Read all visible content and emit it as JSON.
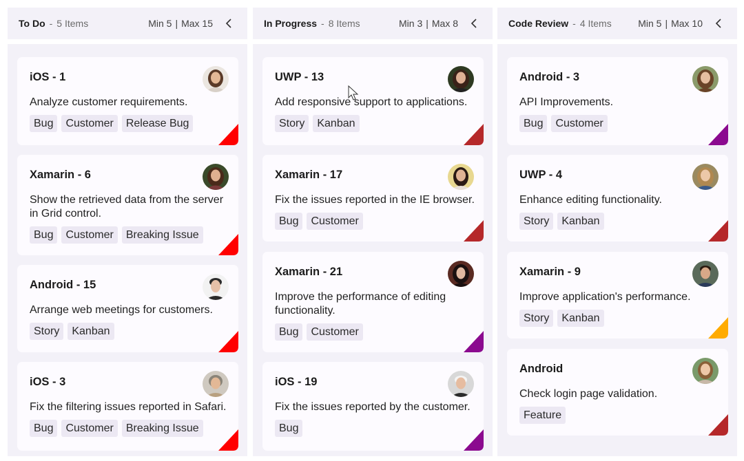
{
  "colors": {
    "red": "#ff0000",
    "darkred": "#b5282a",
    "purple": "#8b0a8f",
    "orange": "#ffab00"
  },
  "columns": [
    {
      "title": "To Do",
      "sep": "-",
      "count": "5 Items",
      "min": "Min 5",
      "bar": "|",
      "max": "Max 15",
      "cards": [
        {
          "title": "iOS - 1",
          "desc": "Analyze customer requirements.",
          "tags": [
            "Bug",
            "Customer",
            "Release Bug"
          ],
          "priority": "red"
        },
        {
          "title": "Xamarin - 6",
          "desc": "Show the retrieved data from the server in Grid control.",
          "tags": [
            "Bug",
            "Customer",
            "Breaking Issue"
          ],
          "priority": "red"
        },
        {
          "title": "Android - 15",
          "desc": "Arrange web meetings for customers.",
          "tags": [
            "Story",
            "Kanban"
          ],
          "priority": "red"
        },
        {
          "title": "iOS - 3",
          "desc": "Fix the filtering issues reported in Safari.",
          "tags": [
            "Bug",
            "Customer",
            "Breaking Issue"
          ],
          "priority": "red"
        }
      ]
    },
    {
      "title": "In Progress",
      "sep": "-",
      "count": "8 Items",
      "min": "Min 3",
      "bar": "|",
      "max": "Max 8",
      "cards": [
        {
          "title": "UWP - 13",
          "desc": "Add responsive support to applications.",
          "tags": [
            "Story",
            "Kanban"
          ],
          "priority": "darkred"
        },
        {
          "title": "Xamarin - 17",
          "desc": "Fix the issues reported in the IE browser.",
          "tags": [
            "Bug",
            "Customer"
          ],
          "priority": "darkred"
        },
        {
          "title": "Xamarin - 21",
          "desc": "Improve the performance of editing functionality.",
          "tags": [
            "Bug",
            "Customer"
          ],
          "priority": "purple"
        },
        {
          "title": "iOS - 19",
          "desc": "Fix the issues reported by the customer.",
          "tags": [
            "Bug"
          ],
          "priority": "purple"
        }
      ]
    },
    {
      "title": "Code Review",
      "sep": "-",
      "count": "4 Items",
      "min": "Min 5",
      "bar": "|",
      "max": "Max 10",
      "cards": [
        {
          "title": "Android - 3",
          "desc": "API Improvements.",
          "tags": [
            "Bug",
            "Customer"
          ],
          "priority": "purple"
        },
        {
          "title": "UWP - 4",
          "desc": "Enhance editing functionality.",
          "tags": [
            "Story",
            "Kanban"
          ],
          "priority": "darkred"
        },
        {
          "title": "Xamarin - 9",
          "desc": "Improve application's performance.",
          "tags": [
            "Story",
            "Kanban"
          ],
          "priority": "orange"
        },
        {
          "title": "Android",
          "desc": "Check login page validation.",
          "tags": [
            "Feature"
          ],
          "priority": "darkred"
        }
      ]
    }
  ]
}
